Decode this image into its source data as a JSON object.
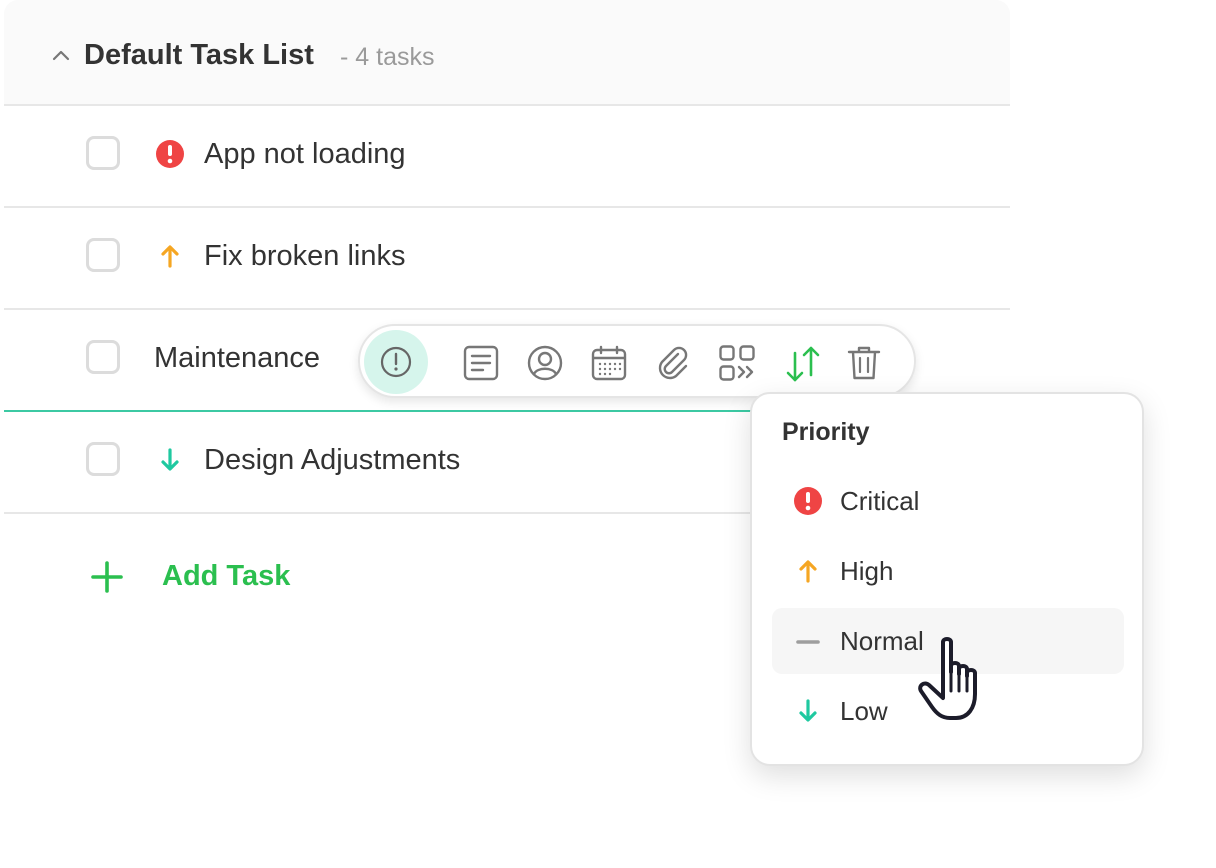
{
  "task_list": {
    "title": "Default Task List",
    "count_label": "- 4 tasks"
  },
  "tasks": [
    {
      "name": "App not loading",
      "priority": "critical",
      "checked": false
    },
    {
      "name": "Fix broken links",
      "priority": "high",
      "checked": false
    },
    {
      "name": "Maintenance",
      "priority": "none",
      "checked": false,
      "editing": true
    },
    {
      "name": "Design Adjustments",
      "priority": "low",
      "checked": false
    }
  ],
  "add_task": {
    "label": "Add Task"
  },
  "toolbar": {
    "buttons": [
      {
        "icon": "priority-icon",
        "selected": true
      },
      {
        "icon": "notes-icon"
      },
      {
        "icon": "assignee-icon"
      },
      {
        "icon": "calendar-icon"
      },
      {
        "icon": "attachment-icon"
      },
      {
        "icon": "move-icon"
      },
      {
        "icon": "sort-icon"
      },
      {
        "icon": "trash-icon"
      }
    ]
  },
  "priority_menu": {
    "title": "Priority",
    "options": [
      {
        "label": "Critical",
        "icon": "critical-icon",
        "color": "#ef4444"
      },
      {
        "label": "High",
        "icon": "arrow-up-icon",
        "color": "#f5a623"
      },
      {
        "label": "Normal",
        "icon": "dash-icon",
        "color": "#9e9e9e",
        "hovered": true
      },
      {
        "label": "Low",
        "icon": "arrow-down-icon",
        "color": "#1fc9a0"
      }
    ]
  },
  "colors": {
    "accent_green": "#2bbf4f",
    "teal": "#3cc9a3",
    "critical_red": "#ef4444",
    "high_orange": "#f5a623",
    "low_teal": "#1fc9a0"
  }
}
